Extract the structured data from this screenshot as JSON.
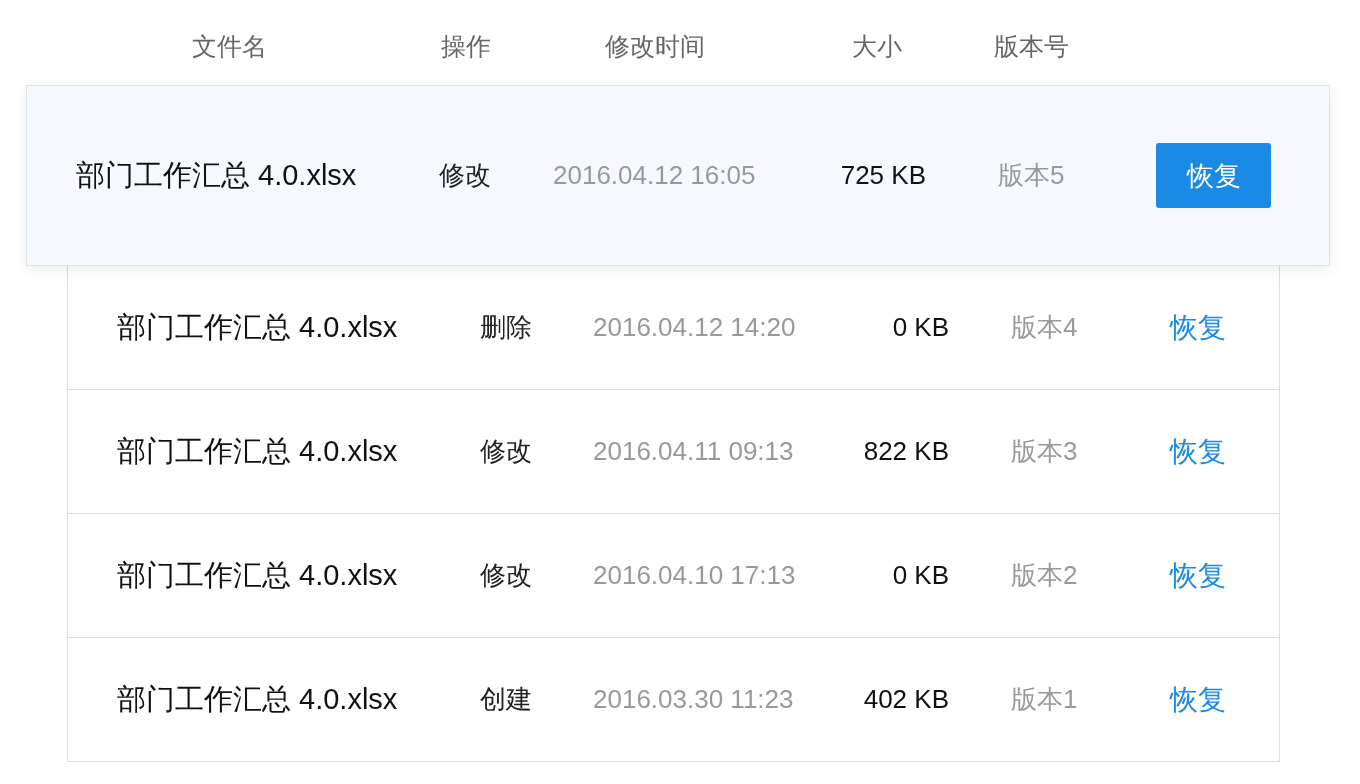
{
  "table": {
    "columns": [
      "文件名",
      "操作",
      "修改时间",
      "大小",
      "版本号"
    ],
    "rows": [
      {
        "name": "部门工作汇总 4.0.xlsx",
        "operation": "修改",
        "modified": "2016.04.12 16:05",
        "size": "725 KB",
        "version": "版本5",
        "action": "恢复",
        "selected": true
      },
      {
        "name": "部门工作汇总 4.0.xlsx",
        "operation": "删除",
        "modified": "2016.04.12 14:20",
        "size": "0 KB",
        "version": "版本4",
        "action": "恢复",
        "selected": false
      },
      {
        "name": "部门工作汇总 4.0.xlsx",
        "operation": "修改",
        "modified": "2016.04.11 09:13",
        "size": "822 KB",
        "version": "版本3",
        "action": "恢复",
        "selected": false
      },
      {
        "name": "部门工作汇总 4.0.xlsx",
        "operation": "修改",
        "modified": "2016.04.10 17:13",
        "size": "0 KB",
        "version": "版本2",
        "action": "恢复",
        "selected": false
      },
      {
        "name": "部门工作汇总 4.0.xlsx",
        "operation": "创建",
        "modified": "2016.03.30 11:23",
        "size": "402 KB",
        "version": "版本1",
        "action": "恢复",
        "selected": false
      }
    ]
  }
}
